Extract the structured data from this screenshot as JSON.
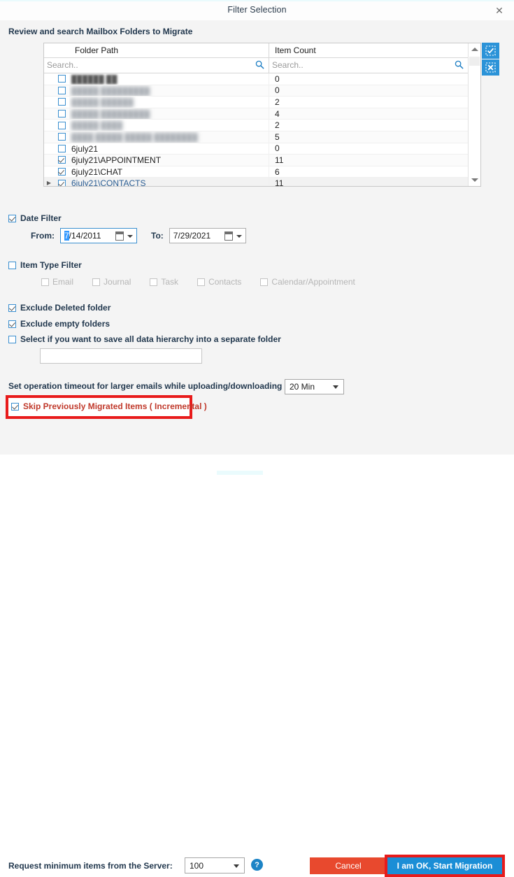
{
  "window": {
    "title": "Filter Selection",
    "close_label": "✕",
    "close_icon": "close-icon"
  },
  "section": {
    "title": "Review and search Mailbox Folders to Migrate"
  },
  "grid": {
    "columns": [
      "Folder Path",
      "Item Count"
    ],
    "search_placeholder_path": "Search..",
    "search_placeholder_count": "Search..",
    "rows": [
      {
        "name": "██████ ██",
        "count": "0",
        "checked": false,
        "redacted": true,
        "selected": false,
        "expander": false
      },
      {
        "name": "█████ █████████",
        "count": "0",
        "checked": false,
        "redacted": true,
        "selected": false,
        "expander": false
      },
      {
        "name": "█████ ██████",
        "count": "2",
        "checked": false,
        "redacted": true,
        "selected": false,
        "expander": false
      },
      {
        "name": "█████ █████████",
        "count": "4",
        "checked": false,
        "redacted": true,
        "selected": false,
        "expander": false
      },
      {
        "name": "█████ ████",
        "count": "2",
        "checked": false,
        "redacted": true,
        "selected": false,
        "expander": false
      },
      {
        "name": "████ █████ █████ ████████",
        "count": "5",
        "checked": false,
        "redacted": true,
        "selected": false,
        "expander": false
      },
      {
        "name": "6july21",
        "count": "0",
        "checked": false,
        "redacted": false,
        "selected": false,
        "expander": false
      },
      {
        "name": "6july21\\APPOINTMENT",
        "count": "11",
        "checked": true,
        "redacted": false,
        "selected": false,
        "expander": false
      },
      {
        "name": "6july21\\CHAT",
        "count": "6",
        "checked": true,
        "redacted": false,
        "selected": false,
        "expander": false
      },
      {
        "name": "6july21\\CONTACTS",
        "count": "11",
        "checked": true,
        "redacted": false,
        "selected": true,
        "expander": true
      }
    ],
    "tools": [
      {
        "name": "select-all-button",
        "glyph": "✓"
      },
      {
        "name": "deselect-all-button",
        "glyph": "✕"
      }
    ]
  },
  "filters": {
    "date_filter": {
      "label": "Date Filter",
      "checked": true
    },
    "from_label": "From:",
    "from_value_selected": "7",
    "from_value_rest": "/14/2011",
    "to_label": "To:",
    "to_value": "7/29/2021",
    "item_type_filter": {
      "label": "Item Type Filter",
      "checked": false
    },
    "item_types": [
      {
        "label": "Email",
        "checked": false
      },
      {
        "label": "Journal",
        "checked": false
      },
      {
        "label": "Task",
        "checked": false
      },
      {
        "label": "Contacts",
        "checked": false
      },
      {
        "label": "Calendar/Appointment",
        "checked": false
      }
    ],
    "exclude_deleted": {
      "label": "Exclude Deleted folder",
      "checked": true
    },
    "exclude_empty": {
      "label": "Exclude empty folders",
      "checked": true
    },
    "separate_folder": {
      "label": "Select if you want to save all data hierarchy into a separate folder",
      "checked": false
    },
    "separate_folder_value": ""
  },
  "timeout": {
    "label": "Set operation timeout for larger emails while uploading/downloading",
    "value": "20 Min"
  },
  "incremental": {
    "label": "Skip Previously Migrated Items ( Incremental )",
    "checked": true,
    "highlight_color": "#e81b1b",
    "text_color": "#c0392b"
  },
  "footer": {
    "request_label": "Request minimum items from the Server:",
    "request_value": "100",
    "help_glyph": "?",
    "cancel_label": "Cancel",
    "ok_label": "I am OK, Start Migration",
    "cancel_color": "#e8492e",
    "ok_color": "#1b8ed6"
  }
}
